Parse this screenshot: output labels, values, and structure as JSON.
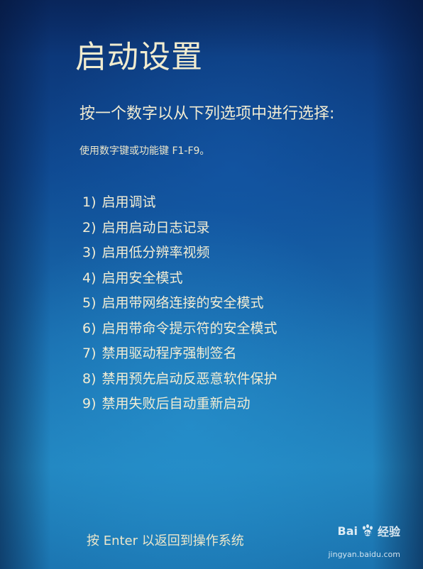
{
  "screen": {
    "title": "启动设置",
    "prompt": "按一个数字以从下列选项中进行选择:",
    "hint": "使用数字键或功能键 F1-F9。",
    "footer": "按 Enter 以返回到操作系统"
  },
  "options": [
    {
      "number": "1)",
      "label": "启用调试"
    },
    {
      "number": "2)",
      "label": "启用启动日志记录"
    },
    {
      "number": "3)",
      "label": "启用低分辨率视频"
    },
    {
      "number": "4)",
      "label": "启用安全模式"
    },
    {
      "number": "5)",
      "label": "启用带网络连接的安全模式"
    },
    {
      "number": "6)",
      "label": "启用带命令提示符的安全模式"
    },
    {
      "number": "7)",
      "label": "禁用驱动程序强制签名"
    },
    {
      "number": "8)",
      "label": "禁用预先启动反恶意软件保护"
    },
    {
      "number": "9)",
      "label": "禁用失败后自动重新启动"
    }
  ],
  "watermark": {
    "brand": "Bai",
    "brand_suffix": "经验",
    "url": "jingyan.baidu.com",
    "icon": "baidu-paw-icon"
  },
  "colors": {
    "text": "#f2edd4",
    "background_top": "#0b2f6e",
    "background_bottom": "#2286c0"
  }
}
